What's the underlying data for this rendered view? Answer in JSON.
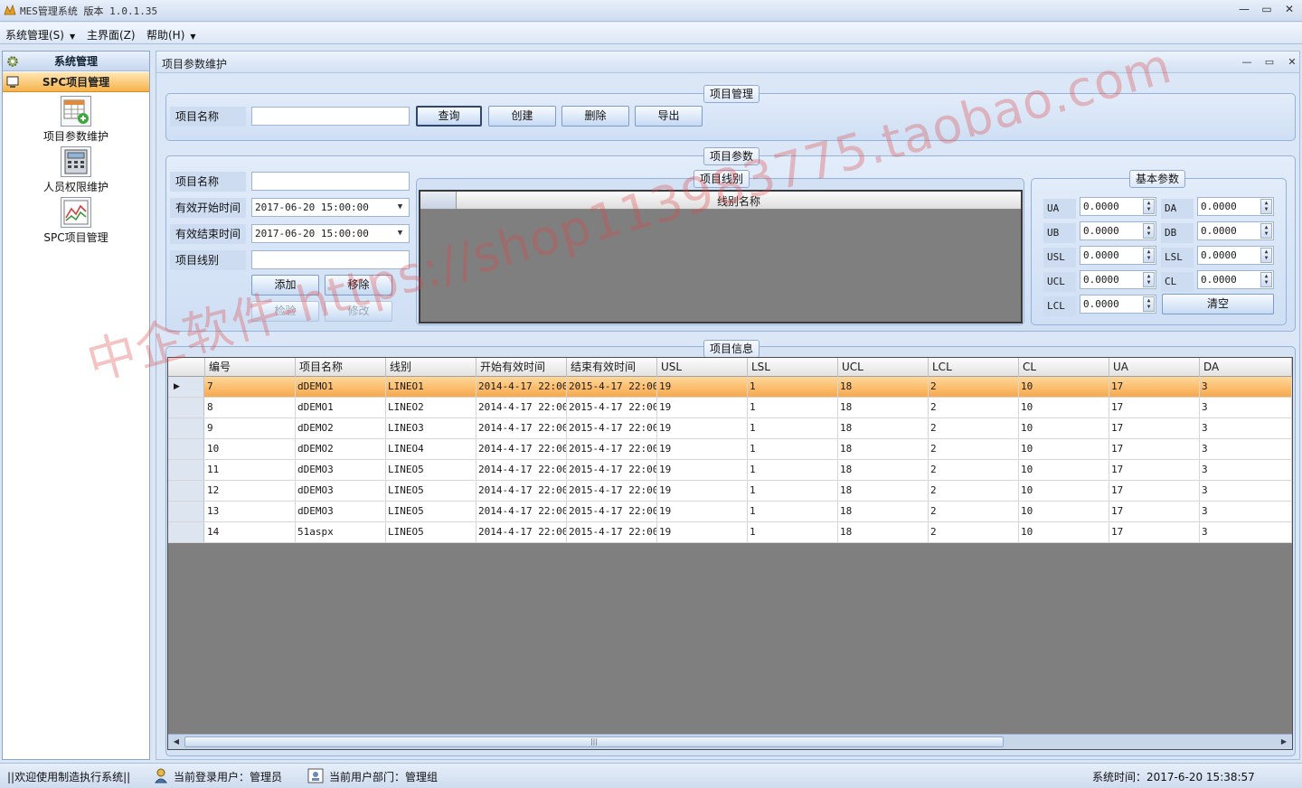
{
  "window": {
    "title": "MES管理系统  版本 1.0.1.35",
    "controls": [
      "—",
      "▭",
      "✕"
    ]
  },
  "menu": [
    {
      "label": "系统管理(S)"
    },
    {
      "label": "主界面(Z)"
    },
    {
      "label": "帮助(H)"
    }
  ],
  "sidebar": {
    "sections": [
      "系统管理",
      "SPC项目管理"
    ],
    "tools": [
      {
        "label": "项目参数维护"
      },
      {
        "label": "人员权限维护"
      },
      {
        "label": "SPC项目管理"
      }
    ]
  },
  "panel": {
    "title": "项目参数维护",
    "project_mgmt": {
      "caption": "项目管理",
      "name_label": "项目名称",
      "name_value": "",
      "buttons": {
        "query": "查询",
        "create": "创建",
        "delete": "删除",
        "export": "导出"
      }
    },
    "project_params": {
      "caption": "项目参数",
      "labels": {
        "name": "项目名称",
        "start": "有效开始时间",
        "end": "有效结束时间",
        "line": "项目线别"
      },
      "values": {
        "name": "",
        "start": "2017-06-20 15:00:00",
        "end": "2017-06-20 15:00:00",
        "line": ""
      },
      "buttons": {
        "add": "添加",
        "remove": "移除",
        "check": "检验",
        "modify": "修改"
      },
      "line_group": {
        "caption": "项目线别",
        "column": "线别名称"
      },
      "basic_params": {
        "caption": "基本参数",
        "fields": [
          {
            "label": "UA",
            "value": "0.0000"
          },
          {
            "label": "DA",
            "value": "0.0000"
          },
          {
            "label": "UB",
            "value": "0.0000"
          },
          {
            "label": "DB",
            "value": "0.0000"
          },
          {
            "label": "USL",
            "value": "0.0000"
          },
          {
            "label": "LSL",
            "value": "0.0000"
          },
          {
            "label": "UCL",
            "value": "0.0000"
          },
          {
            "label": "CL",
            "value": "0.0000"
          },
          {
            "label": "LCL",
            "value": "0.0000"
          }
        ],
        "clear_button": "清空"
      }
    },
    "project_info": {
      "caption": "项目信息",
      "columns": [
        "编号",
        "项目名称",
        "线别",
        "开始有效时间",
        "结束有效时间",
        "USL",
        "LSL",
        "UCL",
        "LCL",
        "CL",
        "UA",
        "DA"
      ],
      "rows": [
        [
          "7",
          "dDEMO1",
          "LINEO1",
          "2014-4-17 22:00",
          "2015-4-17 22:00",
          "19",
          "1",
          "18",
          "2",
          "10",
          "17",
          "3"
        ],
        [
          "8",
          "dDEMO1",
          "LINEO2",
          "2014-4-17 22:00",
          "2015-4-17 22:00",
          "19",
          "1",
          "18",
          "2",
          "10",
          "17",
          "3"
        ],
        [
          "9",
          "dDEMO2",
          "LINEO3",
          "2014-4-17 22:00",
          "2015-4-17 22:00",
          "19",
          "1",
          "18",
          "2",
          "10",
          "17",
          "3"
        ],
        [
          "10",
          "dDEMO2",
          "LINEO4",
          "2014-4-17 22:00",
          "2015-4-17 22:00",
          "19",
          "1",
          "18",
          "2",
          "10",
          "17",
          "3"
        ],
        [
          "11",
          "dDEMO3",
          "LINEO5",
          "2014-4-17 22:00",
          "2015-4-17 22:00",
          "19",
          "1",
          "18",
          "2",
          "10",
          "17",
          "3"
        ],
        [
          "12",
          "dDEMO3",
          "LINEO5",
          "2014-4-17 22:00",
          "2015-4-17 22:00",
          "19",
          "1",
          "18",
          "2",
          "10",
          "17",
          "3"
        ],
        [
          "13",
          "dDEMO3",
          "LINEO5",
          "2014-4-17 22:00",
          "2015-4-17 22:00",
          "19",
          "1",
          "18",
          "2",
          "10",
          "17",
          "3"
        ],
        [
          "14",
          "51aspx",
          "LINEO5",
          "2014-4-17 22:00",
          "2015-4-17 22:00",
          "19",
          "1",
          "18",
          "2",
          "10",
          "17",
          "3"
        ]
      ],
      "selected_row": 0
    }
  },
  "statusbar": {
    "welcome": "||欢迎使用制造执行系统||",
    "user": "当前登录用户：管理员",
    "dept": "当前用户部门：管理组",
    "time": "系统时间：2017-6-20 15:38:57"
  },
  "watermark": "中企软件-https://shop113983775.taobao.com",
  "colors": {
    "selected_row": "#f7a94b",
    "sidebar_active": "#f7b24c",
    "grid_bg": "#7f7f7f"
  }
}
